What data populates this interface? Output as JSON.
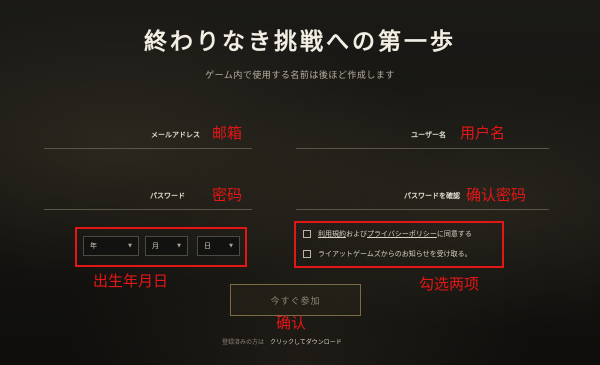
{
  "header": {
    "title": "終わりなき挑戦への第一歩",
    "subtitle": "ゲーム内で使用する名前は後ほど作成します"
  },
  "fields": {
    "email": {
      "label": "メールアドレス",
      "value": ""
    },
    "username": {
      "label": "ユーザー名",
      "value": ""
    },
    "password": {
      "label": "パスワード",
      "value": ""
    },
    "password_confirm": {
      "label": "パスワードを確認",
      "value": ""
    }
  },
  "birthdate": {
    "year": "年",
    "month": "月",
    "day": "日"
  },
  "agreements": {
    "terms_prefix": "利用規約",
    "terms_and": "および",
    "privacy_link": "プライバシーポリシー",
    "terms_suffix": "に同意する",
    "terms_checked": false,
    "newsletter": "ライアットゲームズからのお知らせを受け取る。",
    "newsletter_checked": false
  },
  "join_button": "今すぐ参加",
  "download": {
    "prefix": "登録済みの方は",
    "link": "クリックしてダウンロード"
  },
  "annotations": {
    "email": "邮箱",
    "username": "用户名",
    "password": "密码",
    "password_confirm": "确认密码",
    "birthdate": "出生年月日",
    "agreements": "勾选两项",
    "confirm": "确认"
  },
  "colors": {
    "annotation_red": "#e41616",
    "button_border": "#7a6a45",
    "background": "#151411"
  }
}
